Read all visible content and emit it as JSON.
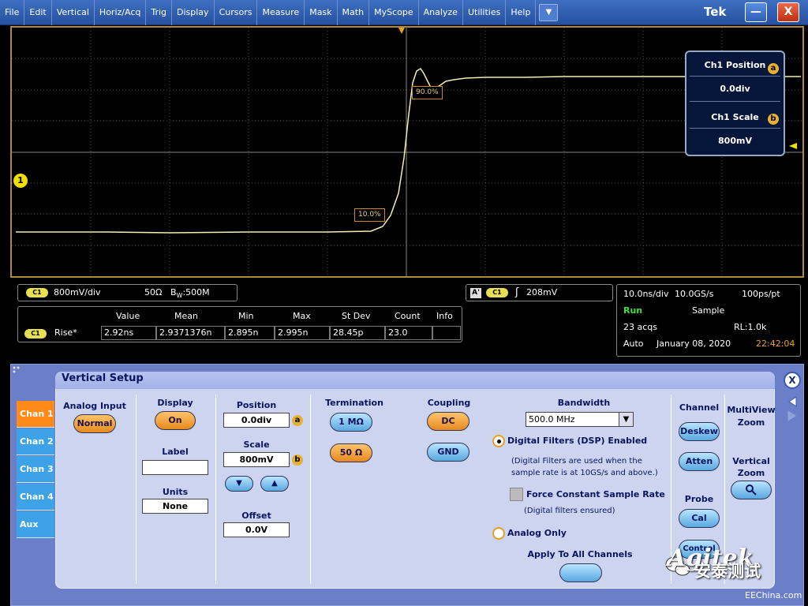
{
  "menu": {
    "items": [
      "File",
      "Edit",
      "Vertical",
      "Horiz/Acq",
      "Trig",
      "Display",
      "Cursors",
      "Measure",
      "Mask",
      "Math",
      "MyScope",
      "Analyze",
      "Utilities",
      "Help"
    ],
    "dropdown": "▼",
    "brand": "Tek",
    "minimize": "—",
    "close": "X"
  },
  "scope": {
    "channel_marker": "1",
    "label_90": "90.0%",
    "label_10": "10.0%",
    "popup": {
      "pos_title": "Ch1 Position",
      "pos_badge": "a",
      "pos_value": "0.0div",
      "scale_title": "Ch1 Scale",
      "scale_badge": "b",
      "scale_value": "800mV"
    }
  },
  "readouts": {
    "ch_tag": "C1",
    "volts_div": "800mV/div",
    "impedance": "50Ω",
    "bw_prefix": "B",
    "bw_sub": "W",
    "bw_value": ":500M",
    "trig_a": "A'",
    "trig_tag": "C1",
    "trig_slope": "ʃ",
    "trig_level": "208mV",
    "time_div": "10.0ns/div",
    "sample_rate": "10.0GS/s",
    "ps_pt": "100ps/pt",
    "run": "Run",
    "mode": "Sample",
    "acqs": "23 acqs",
    "rl": "RL:1.0k",
    "trigger_mode": "Auto",
    "date": "January 08, 2020",
    "time": "22:42:04"
  },
  "measurement": {
    "headers": [
      "Value",
      "Mean",
      "Min",
      "Max",
      "St Dev",
      "Count",
      "Info"
    ],
    "tag": "C1",
    "name": "Rise*",
    "values": [
      "2.92ns",
      "2.9371376n",
      "2.895n",
      "2.995n",
      "28.45p",
      "23.0",
      ""
    ]
  },
  "vertical_setup": {
    "title": "Vertical Setup",
    "tabs": [
      "Chan 1",
      "Chan 2",
      "Chan 3",
      "Chan 4",
      "Aux"
    ],
    "analog_input": "Analog Input",
    "normal": "Normal",
    "display": "Display",
    "on": "On",
    "label": "Label",
    "label_value": "",
    "units": "Units",
    "units_value": "None",
    "position": "Position",
    "position_value": "0.0div",
    "position_badge": "a",
    "scale": "Scale",
    "scale_value": "800mV",
    "scale_badge": "b",
    "down_arrow": "▼",
    "up_arrow": "▲",
    "offset": "Offset",
    "offset_value": "0.0V",
    "termination": "Termination",
    "term_1m": "1 MΩ",
    "term_50": "50 Ω",
    "coupling": "Coupling",
    "dc": "DC",
    "gnd": "GND",
    "bandwidth": "Bandwidth",
    "bandwidth_value": "500.0 MHz",
    "dsp_enabled": "Digital Filters (DSP) Enabled",
    "dsp_note_1": "(Digital Filters are used when the",
    "dsp_note_2": "sample rate is at 10GS/s and above.)",
    "force_constant": "Force Constant Sample Rate",
    "filters_ensured": "(Digital filters ensured)",
    "analog_only": "Analog Only",
    "apply_all": "Apply To All Channels",
    "channel": "Channel",
    "deskew": "Deskew",
    "atten": "Atten",
    "probe": "Probe",
    "cal": "Cal",
    "control": "Control",
    "multiview_1": "MultiView",
    "multiview_2": "Zoom",
    "vertical_zoom_1": "Vertical",
    "vertical_zoom_2": "Zoom"
  },
  "watermark": {
    "brand": "Agitek",
    "cn": "安泰测试",
    "site": "EEChina.com"
  }
}
